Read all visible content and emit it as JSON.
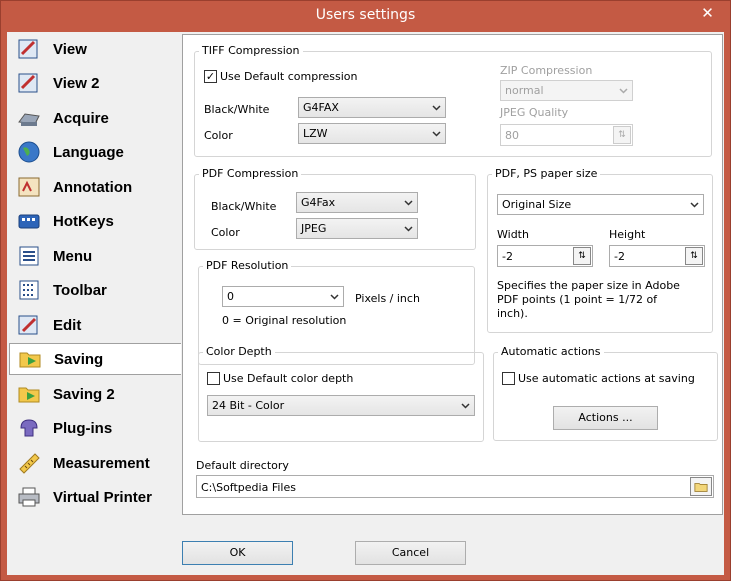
{
  "window": {
    "title": "Users settings",
    "close": "✕"
  },
  "sidebar": {
    "items": [
      {
        "label": "View",
        "icon": "view-icon"
      },
      {
        "label": "View 2",
        "icon": "view2-icon"
      },
      {
        "label": "Acquire",
        "icon": "scanner-icon"
      },
      {
        "label": "Language",
        "icon": "globe-icon"
      },
      {
        "label": "Annotation",
        "icon": "annotation-icon"
      },
      {
        "label": "HotKeys",
        "icon": "keyboard-icon"
      },
      {
        "label": "Menu",
        "icon": "menu-icon"
      },
      {
        "label": "Toolbar",
        "icon": "toolbar-icon"
      },
      {
        "label": "Edit",
        "icon": "edit-icon"
      },
      {
        "label": "Saving",
        "icon": "saving-icon",
        "selected": true
      },
      {
        "label": "Saving 2",
        "icon": "saving2-icon"
      },
      {
        "label": "Plug-ins",
        "icon": "plugin-icon"
      },
      {
        "label": "Measurement",
        "icon": "ruler-icon"
      },
      {
        "label": "Virtual Printer",
        "icon": "printer-icon"
      }
    ]
  },
  "tiff": {
    "legend": "TIFF Compression",
    "use_default": "Use Default compression",
    "use_default_checked": true,
    "bw_label": "Black/White",
    "bw_value": "G4FAX",
    "color_label": "Color",
    "color_value": "LZW",
    "zip_label": "ZIP Compression",
    "zip_value": "normal",
    "jpeg_label": "JPEG Quality",
    "jpeg_value": "80"
  },
  "pdf": {
    "legend": "PDF Compression",
    "bw_label": "Black/White",
    "bw_value": "G4Fax",
    "color_label": "Color",
    "color_value": "JPEG"
  },
  "paper": {
    "legend": "PDF, PS paper size",
    "size_value": "Original Size",
    "width_label": "Width",
    "width_value": "-2",
    "height_label": "Height",
    "height_value": "-2",
    "note": "Specifies the paper size in Adobe PDF points (1 point = 1/72 of inch)."
  },
  "resolution": {
    "legend": "PDF Resolution",
    "value": "0",
    "unit": "Pixels / inch",
    "hint": "0 = Original resolution"
  },
  "depth": {
    "legend": "Color Depth",
    "use_default": "Use Default color depth",
    "use_default_checked": false,
    "value": "24 Bit - Color"
  },
  "auto": {
    "legend": "Automatic actions",
    "checkbox": "Use automatic actions at saving",
    "checked": false,
    "button": "Actions ..."
  },
  "directory": {
    "label": "Default directory",
    "value": "C:\\Softpedia Files"
  },
  "footer": {
    "ok": "OK",
    "cancel": "Cancel"
  },
  "colors": {
    "titlebar": "#c45a44",
    "selection": "#ffffff",
    "panel": "#ffffff"
  }
}
